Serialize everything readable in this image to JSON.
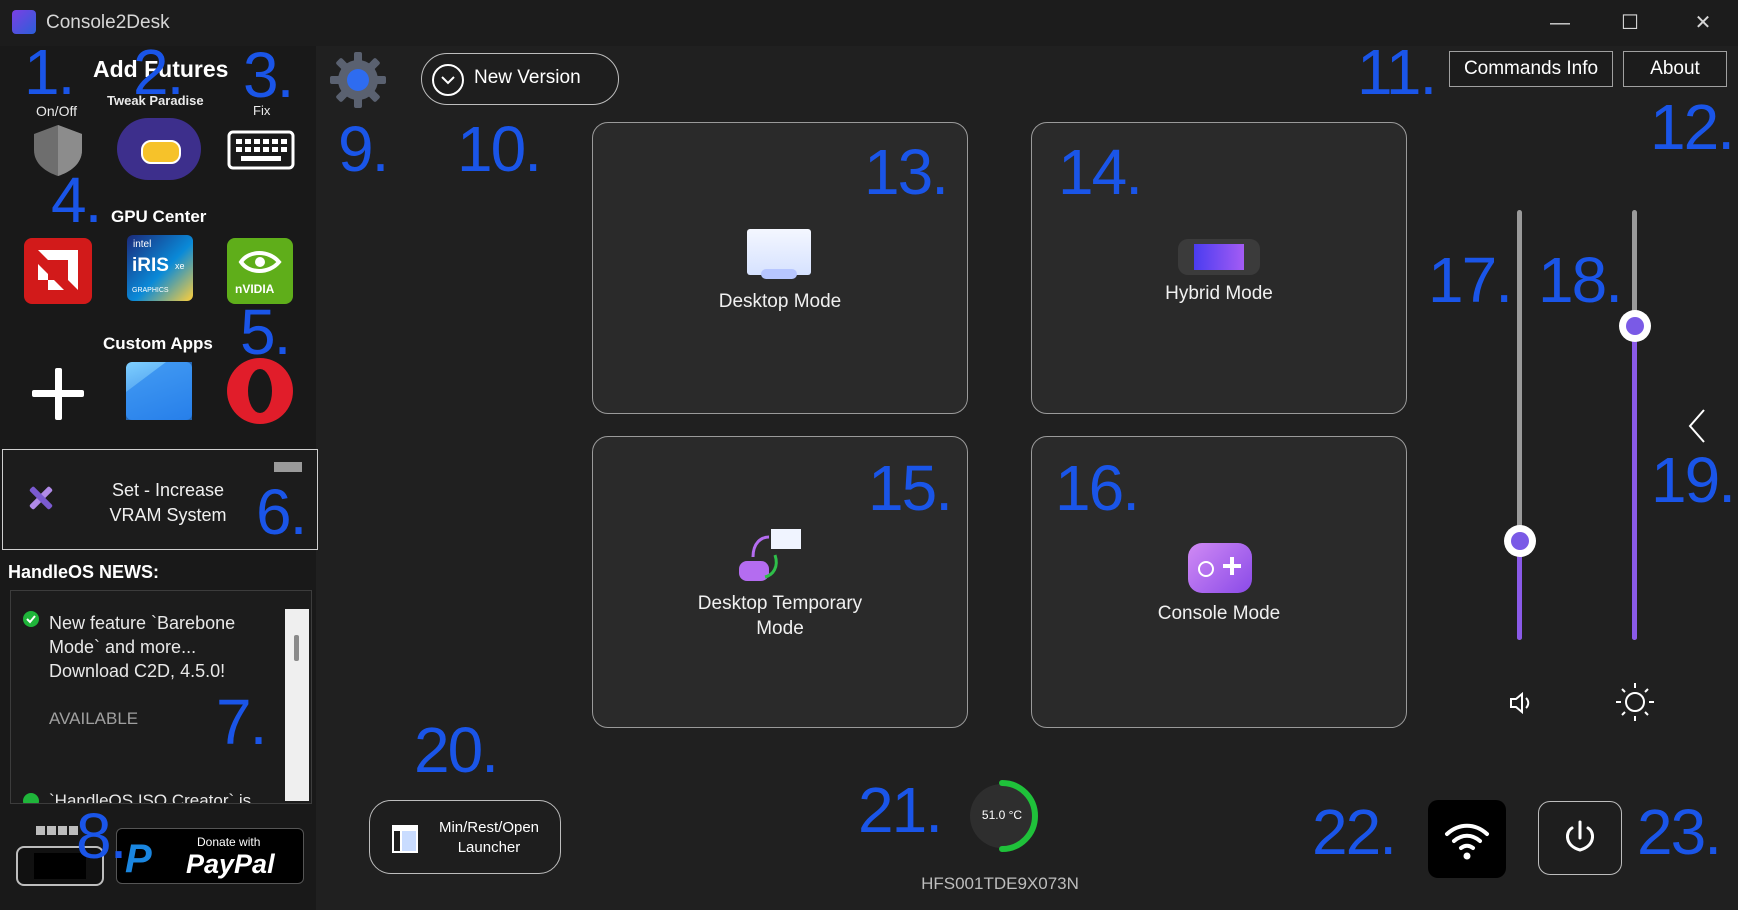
{
  "window": {
    "title": "Console2Desk",
    "minimize_glyph": "—",
    "maximize_glyph": "☐",
    "close_glyph": "✕"
  },
  "callout_numbers": [
    "1.",
    "2.",
    "3.",
    "4.",
    "5.",
    "6.",
    "7.",
    "8.",
    "9.",
    "10.",
    "11.",
    "12.",
    "13.",
    "14.",
    "15.",
    "16.",
    "17.",
    "18.",
    "19.",
    "20.",
    "21.",
    "22.",
    "23."
  ],
  "left": {
    "add_features_title": "Add Futures",
    "onoff_label": "On/Off",
    "tweak_label": "Tweak Paradise",
    "fix_label": "Fix",
    "gpu_center_title": "GPU Center",
    "custom_apps_title": "Custom Apps",
    "vram_line1": "Set - Increase",
    "vram_line2": "VRAM System",
    "news_title": "HandleOS NEWS:",
    "news_item1_line1": "New feature `Barebone",
    "news_item1_line2": "Mode` and more...",
    "news_item1_line3": "Download C2D, 4.5.0!",
    "news_item1_status": "AVAILABLE",
    "news_item2_partial": "`HandleOS ISO Creator` is",
    "paypal_small": "Donate with",
    "paypal_big": "PayPal",
    "gpu_labels": {
      "amd": "AMD",
      "intel_top": "intel",
      "intel_main": "iRIS",
      "intel_xe": "xe",
      "intel_bottom": "GRAPHICS",
      "nvidia": "nVIDIA"
    }
  },
  "toolbar": {
    "new_version_label": "New Version",
    "commands_info_label": "Commands Info",
    "about_label": "About"
  },
  "modes": {
    "desktop": "Desktop Mode",
    "hybrid": "Hybrid Mode",
    "desktop_temp_line1": "Desktop Temporary",
    "desktop_temp_line2": "Mode",
    "console": "Console Mode"
  },
  "sliders": {
    "volume_level_percent": 23,
    "brightness_level_percent": 73
  },
  "bottom": {
    "launcher_line1": "Min/Rest/Open",
    "launcher_line2": "Launcher",
    "temperature": "51.0 °C",
    "temperature_gauge_percent": 50,
    "device_id": "HFS001TDE9X073N"
  },
  "colors": {
    "accent_blue": "#1a55e8",
    "slider_purple": "#8a5ae8",
    "gauge_green": "#1fc13a",
    "background": "#202020"
  }
}
